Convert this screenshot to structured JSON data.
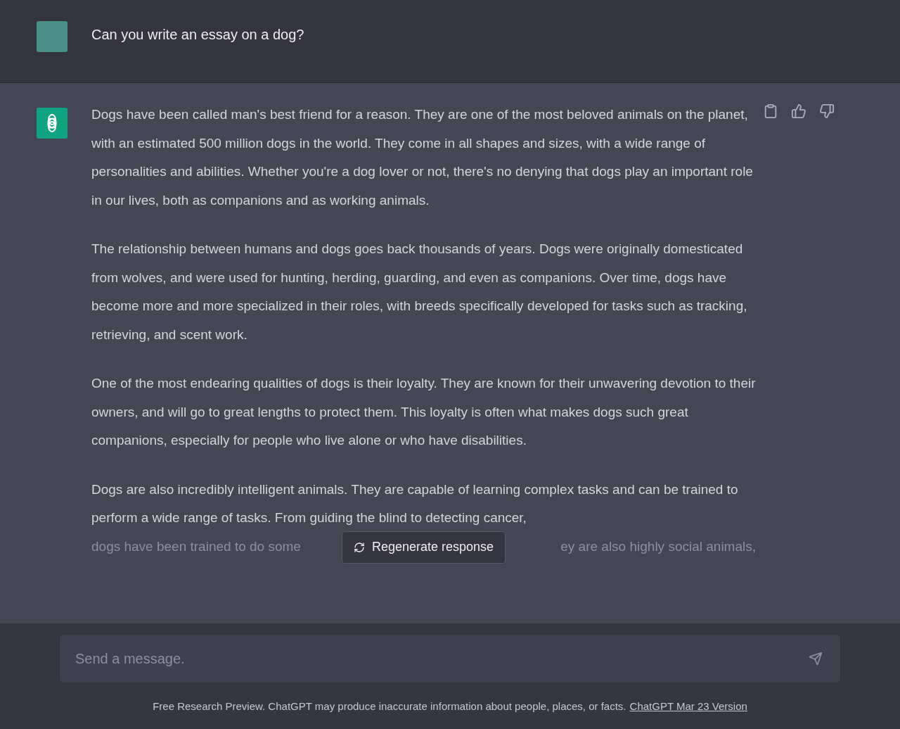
{
  "user_message": {
    "text": "Can you write an essay on a dog?"
  },
  "assistant_message": {
    "paragraphs": [
      "Dogs have been called man's best friend for a reason. They are one of the most beloved animals on the planet, with an estimated 500 million dogs in the world. They come in all shapes and sizes, with a wide range of personalities and abilities. Whether you're a dog lover or not, there's no denying that dogs play an important role in our lives, both as companions and as working animals.",
      "The relationship between humans and dogs goes back thousands of years. Dogs were originally domesticated from wolves, and were used for hunting, herding, guarding, and even as companions. Over time, dogs have become more and more specialized in their roles, with breeds specifically developed for tasks such as tracking, retrieving, and scent work.",
      "One of the most endearing qualities of dogs is their loyalty. They are known for their unwavering devotion to their owners, and will go to great lengths to protect them. This loyalty is often what makes dogs such great companions, especially for people who live alone or who have disabilities.",
      "Dogs are also incredibly intelligent animals. They are capable of learning complex tasks and can be trained to perform a wide range of tasks. From guiding the blind to detecting cancer,"
    ],
    "partial_line": [
      "dogs have been trained to do some",
      "ey are also highly social animals,"
    ]
  },
  "regenerate_button": {
    "label": "Regenerate response"
  },
  "composer": {
    "placeholder": "Send a message."
  },
  "footer": {
    "text": "Free Research Preview. ChatGPT may produce inaccurate information about people, places, or facts.",
    "link": "ChatGPT Mar 23 Version"
  }
}
